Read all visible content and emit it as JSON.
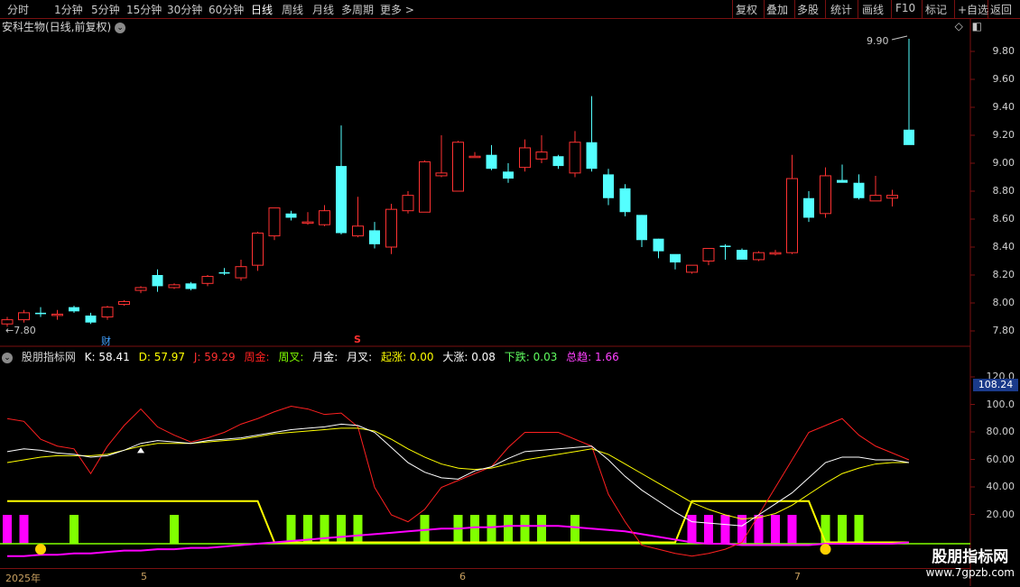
{
  "toolbar": {
    "timeframes": [
      "分时",
      "1分钟",
      "5分钟",
      "15分钟",
      "30分钟",
      "60分钟",
      "日线",
      "周线",
      "月线",
      "多周期",
      "更多 >"
    ],
    "active_index": 6,
    "buttons": [
      "复权",
      "叠加",
      "多股",
      "统计",
      "画线",
      "F10",
      "标记",
      "+自选",
      "返回"
    ]
  },
  "main_title": "安科生物(日线,前复权)",
  "price_axis": [
    "9.80",
    "9.60",
    "9.40",
    "9.20",
    "9.00",
    "8.80",
    "8.60",
    "8.40",
    "8.20",
    "8.00",
    "7.80"
  ],
  "max_label": "9.90",
  "min_label": "7.80",
  "marker_cai": "财",
  "marker_s": "S",
  "indicator": {
    "name": "股朋指标网",
    "k": "K: 58.41",
    "d": "D: 57.97",
    "j": "J: 59.29",
    "zhou_jin": "周金:",
    "zhou_cha": "周叉:",
    "yue_jin": "月金:",
    "yue_cha": "月叉:",
    "qi_zhang": "起涨: 0.00",
    "da_zhang": "大涨: 0.08",
    "xia_die": "下跌: 0.03",
    "zong_qu": "总趋: 1.66"
  },
  "ind_axis": [
    "120.0",
    "100.0",
    "80.00",
    "60.00",
    "40.00",
    "20.00"
  ],
  "current_tag": "108.24",
  "dates": [
    "2025年",
    "5",
    "6",
    "7"
  ],
  "watermark": {
    "title": "股朋指标网",
    "url": "www.7gpzb.com"
  },
  "colors": {
    "up": "#ff3232",
    "down": "#54ffff",
    "k": "#ffffff",
    "d": "#ffff00",
    "j": "#ff2020",
    "magenta": "#ff00ff",
    "green": "#80ff00"
  },
  "candles": [
    [
      7.85,
      7.9,
      7.83,
      7.88
    ],
    [
      7.88,
      7.95,
      7.86,
      7.93
    ],
    [
      7.93,
      7.97,
      7.9,
      7.92
    ],
    [
      7.92,
      7.95,
      7.88,
      7.92
    ],
    [
      7.97,
      7.98,
      7.93,
      7.94
    ],
    [
      7.91,
      7.93,
      7.85,
      7.86
    ],
    [
      7.9,
      7.98,
      7.88,
      7.97
    ],
    [
      7.99,
      8.02,
      7.98,
      8.01
    ],
    [
      8.09,
      8.12,
      8.07,
      8.11
    ],
    [
      8.2,
      8.24,
      8.08,
      8.12
    ],
    [
      8.11,
      8.14,
      8.1,
      8.13
    ],
    [
      8.14,
      8.15,
      8.09,
      8.1
    ],
    [
      8.14,
      8.2,
      8.12,
      8.19
    ],
    [
      8.22,
      8.25,
      8.2,
      8.21
    ],
    [
      8.18,
      8.31,
      8.16,
      8.26
    ],
    [
      8.27,
      8.51,
      8.23,
      8.5
    ],
    [
      8.48,
      8.68,
      8.45,
      8.68
    ],
    [
      8.64,
      8.66,
      8.59,
      8.61
    ],
    [
      8.58,
      8.65,
      8.56,
      8.58
    ],
    [
      8.56,
      8.7,
      8.55,
      8.66
    ],
    [
      8.98,
      9.27,
      8.49,
      8.5
    ],
    [
      8.48,
      8.76,
      8.47,
      8.55
    ],
    [
      8.52,
      8.58,
      8.39,
      8.42
    ],
    [
      8.4,
      8.71,
      8.35,
      8.67
    ],
    [
      8.66,
      8.8,
      8.64,
      8.77
    ],
    [
      8.65,
      9.02,
      8.65,
      9.01
    ],
    [
      8.91,
      9.2,
      8.9,
      8.93
    ],
    [
      8.8,
      9.16,
      8.8,
      9.15
    ],
    [
      9.05,
      9.08,
      9.04,
      9.05
    ],
    [
      9.06,
      9.13,
      8.95,
      8.96
    ],
    [
      8.94,
      9.0,
      8.86,
      8.89
    ],
    [
      8.97,
      9.17,
      8.94,
      9.11
    ],
    [
      9.03,
      9.2,
      9.0,
      9.08
    ],
    [
      9.05,
      9.06,
      8.96,
      8.98
    ],
    [
      8.93,
      9.23,
      8.9,
      9.15
    ],
    [
      9.15,
      9.48,
      8.94,
      8.96
    ],
    [
      8.92,
      8.96,
      8.7,
      8.75
    ],
    [
      8.82,
      8.85,
      8.62,
      8.65
    ],
    [
      8.63,
      8.63,
      8.4,
      8.45
    ],
    [
      8.46,
      8.46,
      8.32,
      8.37
    ],
    [
      8.35,
      8.33,
      8.24,
      8.29
    ],
    [
      8.22,
      8.26,
      8.21,
      8.27
    ],
    [
      8.3,
      8.39,
      8.27,
      8.39
    ],
    [
      8.41,
      8.42,
      8.31,
      8.4
    ],
    [
      8.38,
      8.39,
      8.31,
      8.31
    ],
    [
      8.31,
      8.37,
      8.3,
      8.36
    ],
    [
      8.35,
      8.38,
      8.34,
      8.36
    ],
    [
      8.36,
      9.06,
      8.35,
      8.89
    ],
    [
      8.75,
      8.8,
      8.58,
      8.61
    ],
    [
      8.64,
      8.97,
      8.61,
      8.91
    ],
    [
      8.88,
      8.99,
      8.87,
      8.86
    ],
    [
      8.86,
      8.92,
      8.74,
      8.75
    ],
    [
      8.73,
      8.91,
      8.73,
      8.77
    ],
    [
      8.75,
      8.81,
      8.69,
      8.77
    ],
    [
      9.24,
      9.89,
      9.15,
      9.13
    ]
  ],
  "k_line": [
    66,
    68,
    67,
    65,
    64,
    62,
    63,
    67,
    72,
    74,
    73,
    72,
    74,
    75,
    76,
    78,
    80,
    82,
    83,
    84,
    86,
    85,
    80,
    69,
    58,
    51,
    47,
    46,
    52,
    55,
    61,
    66,
    67,
    68,
    69,
    70,
    60,
    48,
    38,
    30,
    22,
    15,
    14,
    13,
    12,
    20,
    28,
    36,
    47,
    58,
    62,
    62,
    60,
    60,
    58
  ],
  "d_line": [
    58,
    60,
    62,
    63,
    63,
    63,
    64,
    67,
    70,
    72,
    72,
    72,
    73,
    74,
    75,
    77,
    79,
    80,
    81,
    82,
    83,
    83,
    81,
    75,
    68,
    62,
    57,
    54,
    53,
    54,
    57,
    60,
    62,
    64,
    66,
    68,
    64,
    57,
    50,
    43,
    36,
    29,
    24,
    20,
    17,
    18,
    21,
    27,
    35,
    43,
    50,
    54,
    57,
    58,
    58
  ],
  "j_line": [
    90,
    88,
    75,
    70,
    68,
    50,
    70,
    85,
    97,
    84,
    78,
    73,
    76,
    80,
    86,
    90,
    95,
    99,
    97,
    93,
    94,
    84,
    40,
    20,
    15,
    24,
    40,
    45,
    50,
    55,
    69,
    80,
    80,
    80,
    75,
    70,
    35,
    15,
    -2,
    -5,
    -8,
    -10,
    -8,
    -5,
    0,
    20,
    40,
    60,
    80,
    85,
    90,
    78,
    70,
    65,
    60
  ],
  "yellow_line": [
    30,
    30,
    30,
    30,
    30,
    30,
    30,
    30,
    30,
    30,
    30,
    30,
    30,
    30,
    30,
    30,
    0,
    0,
    0,
    0,
    0,
    0,
    0,
    0,
    0,
    0,
    0,
    0,
    0,
    0,
    0,
    0,
    0,
    0,
    0,
    0,
    0,
    0,
    0,
    0,
    0,
    30,
    30,
    30,
    30,
    30,
    30,
    30,
    30,
    0,
    0,
    0,
    0,
    0,
    0
  ],
  "magenta_line": [
    -10,
    -10,
    -9,
    -9,
    -8,
    -8,
    -7,
    -6,
    -6,
    -5,
    -5,
    -4,
    -4,
    -3,
    -2,
    -1,
    0,
    1,
    2,
    3,
    4,
    5,
    6,
    7,
    8,
    9,
    10,
    10,
    11,
    11,
    12,
    12,
    12,
    12,
    11,
    10,
    9,
    8,
    6,
    4,
    2,
    0,
    -1,
    -1,
    -2,
    -2,
    -2,
    -2,
    -2,
    -1,
    -1,
    -1,
    -1,
    -1,
    0
  ],
  "green_bars": [
    4,
    10,
    17,
    18,
    19,
    20,
    21,
    25,
    27,
    28,
    29,
    30,
    31,
    32,
    34,
    49,
    50,
    51
  ],
  "magenta_bars": [
    0,
    1,
    41,
    42,
    43,
    44,
    45,
    46,
    47
  ]
}
